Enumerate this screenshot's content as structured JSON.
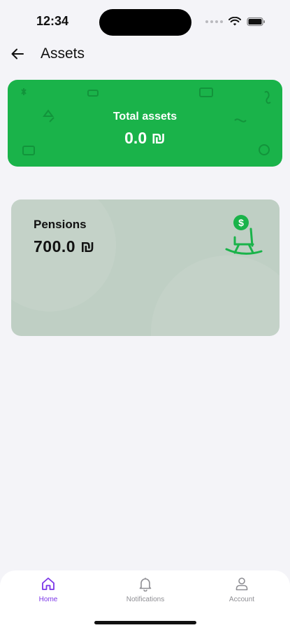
{
  "status_bar": {
    "time": "12:34"
  },
  "header": {
    "title": "Assets",
    "back_icon": "arrow-left-icon"
  },
  "total_card": {
    "label": "Total assets",
    "value": "0.0 ₪",
    "background": "#1ab34a"
  },
  "pension_card": {
    "label": "Pensions",
    "value": "700.0 ₪",
    "icon": "rocking-chair-coin-icon",
    "background": "#bfcfc4",
    "icon_color": "#1ab34a"
  },
  "tabbar": {
    "items": [
      {
        "label": "Home",
        "icon": "home-icon",
        "active": true
      },
      {
        "label": "Notifications",
        "icon": "bell-icon",
        "active": false
      },
      {
        "label": "Account",
        "icon": "person-icon",
        "active": false
      }
    ],
    "active_color": "#7b35e8"
  }
}
